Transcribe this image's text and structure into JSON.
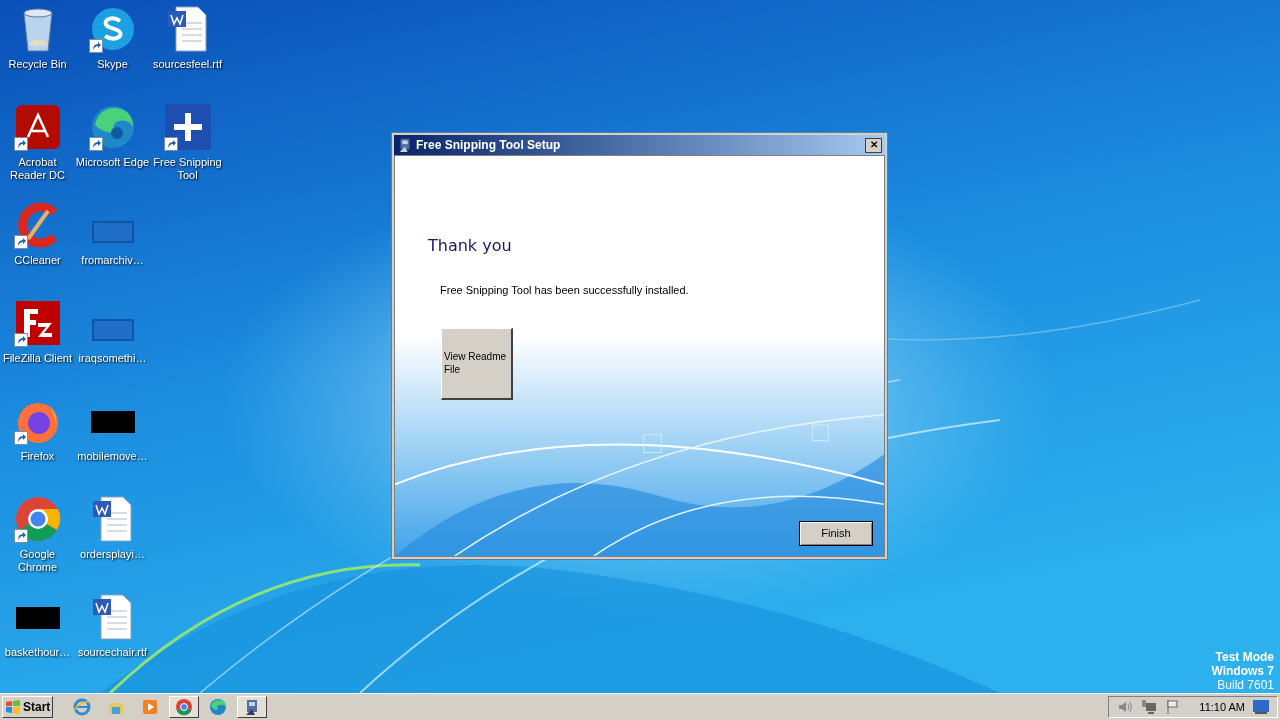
{
  "desktop_icons": [
    {
      "label": "Recycle Bin",
      "kind": "recycle",
      "shortcut": false
    },
    {
      "label": "Acrobat Reader DC",
      "kind": "acrobat",
      "shortcut": true
    },
    {
      "label": "CCleaner",
      "kind": "ccleaner",
      "shortcut": true
    },
    {
      "label": "FileZilla Client",
      "kind": "filezilla",
      "shortcut": true
    },
    {
      "label": "Firefox",
      "kind": "firefox",
      "shortcut": true
    },
    {
      "label": "Google Chrome",
      "kind": "chrome",
      "shortcut": true
    },
    {
      "label": "baskethour…",
      "kind": "black",
      "shortcut": false
    },
    {
      "label": "Skype",
      "kind": "skype",
      "shortcut": true
    },
    {
      "label": "Microsoft Edge",
      "kind": "edge",
      "shortcut": true
    },
    {
      "label": "fromarchiv…",
      "kind": "blank",
      "shortcut": false
    },
    {
      "label": "iraqsomethi…",
      "kind": "blank",
      "shortcut": false
    },
    {
      "label": "mobilemove…",
      "kind": "black",
      "shortcut": false
    },
    {
      "label": "ordersplayi…",
      "kind": "word",
      "shortcut": false
    },
    {
      "label": "sourcechair.rtf",
      "kind": "word",
      "shortcut": false
    },
    {
      "label": "sourcesfeel.rtf",
      "kind": "word",
      "shortcut": false
    },
    {
      "label": "Free Snipping Tool",
      "kind": "plus",
      "shortcut": true
    }
  ],
  "dialog": {
    "title": "Free Snipping Tool Setup",
    "close": "✕",
    "heading": "Thank you",
    "message": "Free Snipping Tool has been successfully installed.",
    "readme_button": "View Readme File",
    "finish_button": "Finish"
  },
  "os_watermark": [
    "Test Mode",
    "Windows 7",
    "Build 7601"
  ],
  "taskbar": {
    "start": "Start",
    "apps": [
      {
        "kind": "ie",
        "active": false
      },
      {
        "kind": "explorer",
        "active": false
      },
      {
        "kind": "media",
        "active": false
      },
      {
        "kind": "chrome",
        "active": true
      },
      {
        "kind": "edge",
        "active": false
      },
      {
        "kind": "setup",
        "active": true
      }
    ],
    "clock": "11:10 AM"
  }
}
